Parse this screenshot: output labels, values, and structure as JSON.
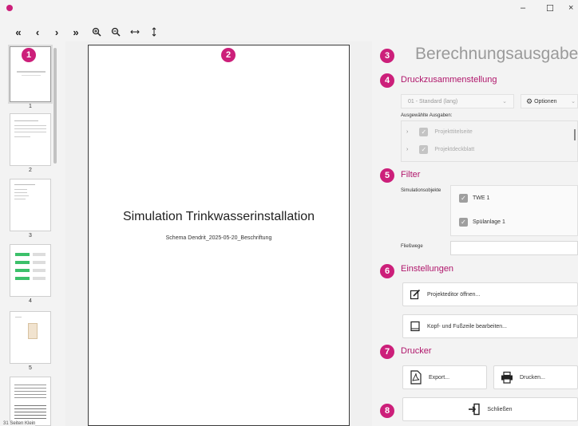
{
  "window": {
    "minimize": "–",
    "maximize": "☐",
    "close": "×"
  },
  "toolbar": {
    "first": "«",
    "prev": "‹",
    "next": "›",
    "last": "»",
    "zoom_in": "🔍︎",
    "zoom_out": "🔍︎",
    "fit_width": "↔",
    "fit_height": "↕"
  },
  "thumbnails": {
    "pages": [
      "1",
      "2",
      "3",
      "4",
      "5"
    ],
    "footer": "31 Seiten  Klein"
  },
  "preview": {
    "title": "Simulation Trinkwasserinstallation",
    "subtitle": "Schema Dendrit_2025-05-20_Beschriftung"
  },
  "badges": [
    "1",
    "2",
    "3",
    "4",
    "5",
    "6",
    "7",
    "8"
  ],
  "panel": {
    "heading": "Berechnungsausgabe",
    "print_composition": {
      "title": "Druckzusammenstellung",
      "preset_value": "01 - Standard (lang)",
      "options_label": "Optionen",
      "selected_outputs_label": "Ausgewählte Ausgaben:",
      "items": [
        "Projekttitelseite",
        "Projektdeckblatt"
      ]
    },
    "filter": {
      "title": "Filter",
      "sim_objects_label": "Simulationsobjekte",
      "sim_objects": [
        "TWE 1",
        "Spülanlage 1"
      ],
      "flow_paths_label": "Fließwege"
    },
    "settings": {
      "title": "Einstellungen",
      "open_project_editor": "Projekteditor öffnen...",
      "edit_header_footer": "Kopf- und Fußzeile bearbeiten..."
    },
    "printer": {
      "title": "Drucker",
      "export": "Export...",
      "print": "Drucken..."
    },
    "close": "Schließen"
  },
  "colors": {
    "accent": "#cc1f7a",
    "section": "#b0166b",
    "heading": "#9a9a9a"
  }
}
